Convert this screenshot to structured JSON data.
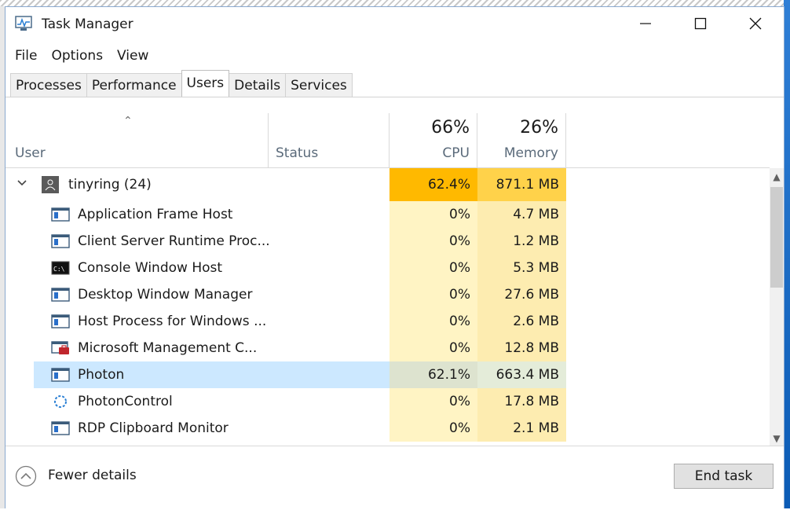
{
  "window": {
    "title": "Task Manager"
  },
  "menu": [
    "File",
    "Options",
    "View"
  ],
  "tabs": [
    {
      "label": "Processes",
      "active": false
    },
    {
      "label": "Performance",
      "active": false
    },
    {
      "label": "Users",
      "active": true
    },
    {
      "label": "Details",
      "active": false
    },
    {
      "label": "Services",
      "active": false
    }
  ],
  "columns": {
    "user": "User",
    "status": "Status",
    "cpu": {
      "label": "CPU",
      "total": "66%"
    },
    "memory": {
      "label": "Memory",
      "total": "26%"
    }
  },
  "group": {
    "name": "tinyring (24)",
    "cpu": "62.4%",
    "memory": "871.1 MB"
  },
  "processes": [
    {
      "name": "Application Frame Host",
      "cpu": "0%",
      "memory": "4.7 MB",
      "icon": "window-icon"
    },
    {
      "name": "Client Server Runtime Proc...",
      "cpu": "0%",
      "memory": "1.2 MB",
      "icon": "window-icon"
    },
    {
      "name": "Console Window Host",
      "cpu": "0%",
      "memory": "5.3 MB",
      "icon": "console-icon"
    },
    {
      "name": "Desktop Window Manager",
      "cpu": "0%",
      "memory": "27.6 MB",
      "icon": "window-icon"
    },
    {
      "name": "Host Process for Windows ...",
      "cpu": "0%",
      "memory": "2.6 MB",
      "icon": "window-icon"
    },
    {
      "name": "Microsoft Management C...",
      "cpu": "0%",
      "memory": "12.8 MB",
      "icon": "mmc-icon"
    },
    {
      "name": "Photon",
      "cpu": "62.1%",
      "memory": "663.4 MB",
      "icon": "window-icon",
      "selected": true
    },
    {
      "name": "PhotonControl",
      "cpu": "0%",
      "memory": "17.8 MB",
      "icon": "loading-ring-icon"
    },
    {
      "name": "RDP Clipboard Monitor",
      "cpu": "0%",
      "memory": "2.1 MB",
      "icon": "window-icon"
    }
  ],
  "footer": {
    "fewer_details": "Fewer details",
    "end_task": "End task"
  },
  "colors": {
    "group_cpu": "#ffb900",
    "group_mem": "#ffd24a",
    "cpu_cell": "#fff4c4",
    "mem_cell": "#fdecb0",
    "selection": "#cce8ff"
  }
}
